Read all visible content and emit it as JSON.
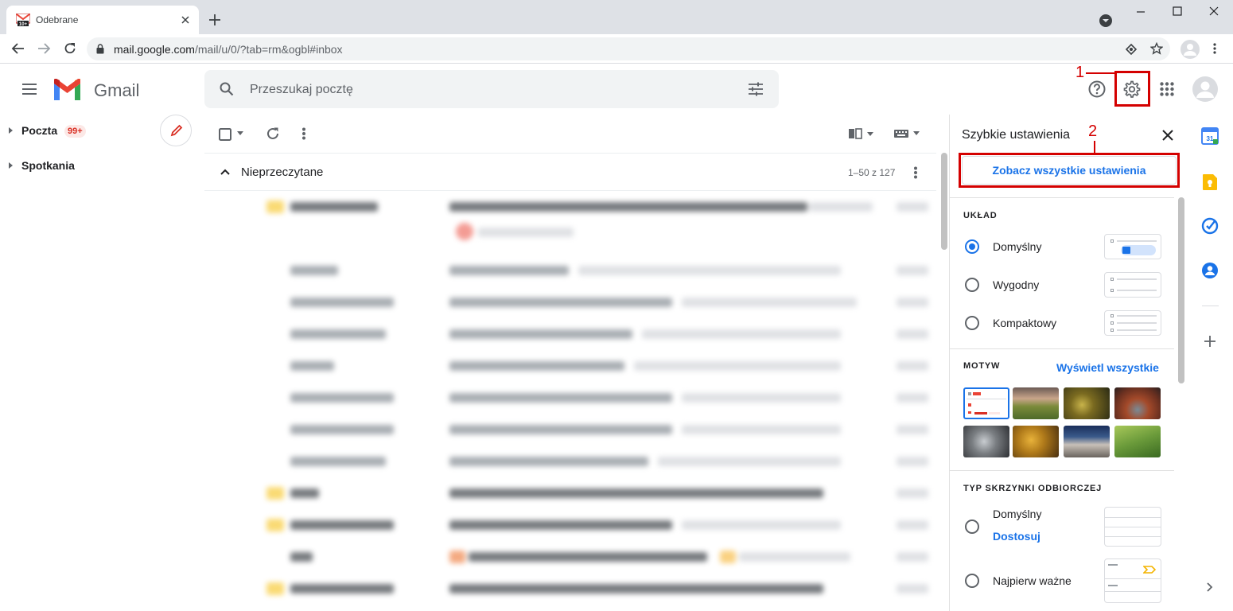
{
  "browser": {
    "tab_title": "Odebrane",
    "url_host": "mail.google.com",
    "url_path": "/mail/u/0/?tab=rm&ogbl#inbox"
  },
  "gmail": {
    "logo_text": "Gmail",
    "search_placeholder": "Przeszukaj pocztę"
  },
  "annotations": {
    "marker_1": "1",
    "marker_2": "2",
    "accent_color": "#d40000"
  },
  "nav": {
    "items": [
      {
        "label": "Poczta",
        "badge": "99+"
      },
      {
        "label": "Spotkania"
      }
    ]
  },
  "toolbar": {
    "section_title": "Nieprzeczytane",
    "page_range": "1–50 z 127"
  },
  "quick_settings": {
    "title": "Szybkie ustawienia",
    "see_all_button": "Zobacz wszystkie ustawienia",
    "layout_label": "UKŁAD",
    "layout_options": [
      {
        "label": "Domyślny",
        "selected": true
      },
      {
        "label": "Wygodny",
        "selected": false
      },
      {
        "label": "Kompaktowy",
        "selected": false
      }
    ],
    "theme_label": "MOTYW",
    "theme_view_all": "Wyświetl wszystkie",
    "inbox_type_label": "TYP SKRZYNKI ODBIORCZEJ",
    "inbox_options": [
      {
        "label": "Domyślny",
        "link": "Dostosuj",
        "selected": false
      },
      {
        "label": "Najpierw ważne",
        "selected": false
      }
    ]
  },
  "colors": {
    "accent_blue": "#1a73e8",
    "link_blue": "#1a73e8",
    "gmail_red": "#ea4335"
  }
}
